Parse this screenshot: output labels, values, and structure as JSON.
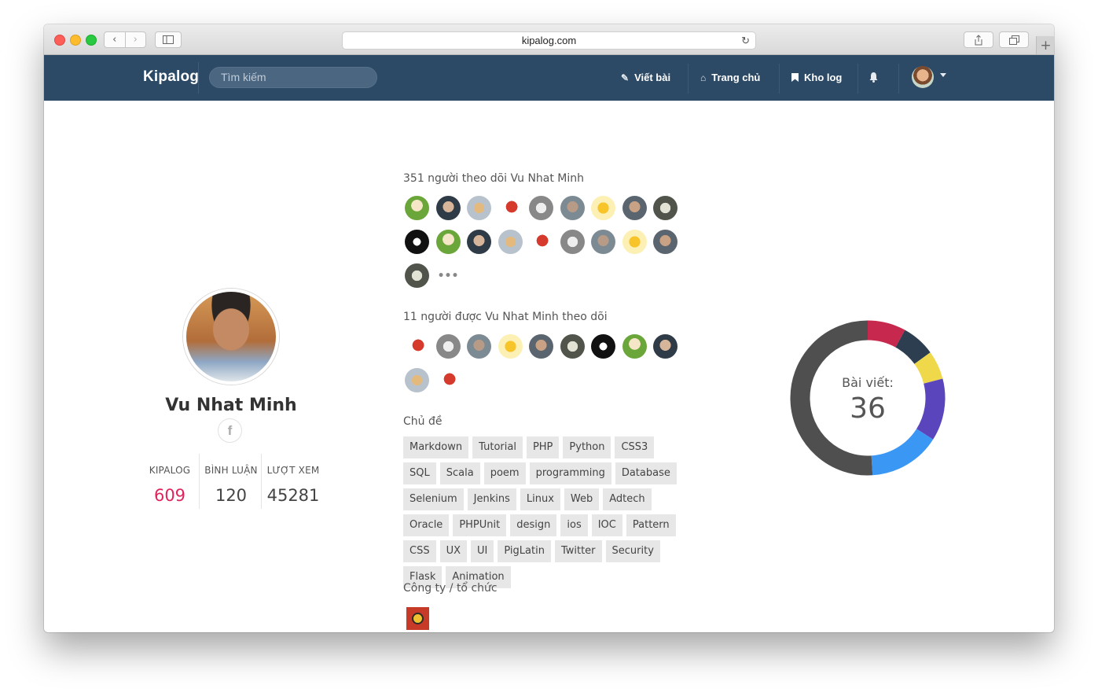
{
  "browser": {
    "url": "kipalog.com"
  },
  "navbar": {
    "brand": "Kipalog",
    "search_placeholder": "Tìm kiếm",
    "items": [
      {
        "label": "Viết bài",
        "icon": "edit-icon"
      },
      {
        "label": "Trang chủ",
        "icon": "home-icon"
      },
      {
        "label": "Kho log",
        "icon": "bookmark-icon"
      }
    ]
  },
  "profile": {
    "name": "Vu Nhat Minh",
    "facebook_label": "f",
    "stats": [
      {
        "label": "KIPALOG",
        "value": "609"
      },
      {
        "label": "BÌNH LUẬN",
        "value": "120"
      },
      {
        "label": "LƯỢT XEM",
        "value": "45281"
      }
    ]
  },
  "followers": {
    "title": "351 người theo dõi Vu Nhat Minh",
    "more": "•••"
  },
  "following": {
    "title": "11 người được Vu Nhat Minh theo dõi"
  },
  "topics": {
    "title": "Chủ đề",
    "tags": [
      "Markdown",
      "Tutorial",
      "PHP",
      "Python",
      "CSS3",
      "SQL",
      "Scala",
      "poem",
      "programming",
      "Database",
      "Selenium",
      "Jenkins",
      "Linux",
      "Web",
      "Adtech",
      "Oracle",
      "PHPUnit",
      "design",
      "ios",
      "IOC",
      "Pattern",
      "CSS",
      "UX",
      "UI",
      "PigLatin",
      "Twitter",
      "Security",
      "Flask",
      "Animation"
    ]
  },
  "organizations": {
    "title": "Công ty / tổ chức"
  },
  "posts_chart": {
    "label": "Bài viết:",
    "value": "36"
  },
  "chart_data": {
    "type": "pie",
    "title": "Bài viết:",
    "total": 36,
    "slices": [
      {
        "value": 8,
        "color": "#c7284e"
      },
      {
        "value": 7,
        "color": "#2c3e50"
      },
      {
        "value": 6,
        "color": "#efd84a"
      },
      {
        "value": 13,
        "color": "#5b45bd"
      },
      {
        "value": 15,
        "color": "#3a97f3"
      },
      {
        "value": 51,
        "color": "#4f4f4f"
      }
    ]
  }
}
